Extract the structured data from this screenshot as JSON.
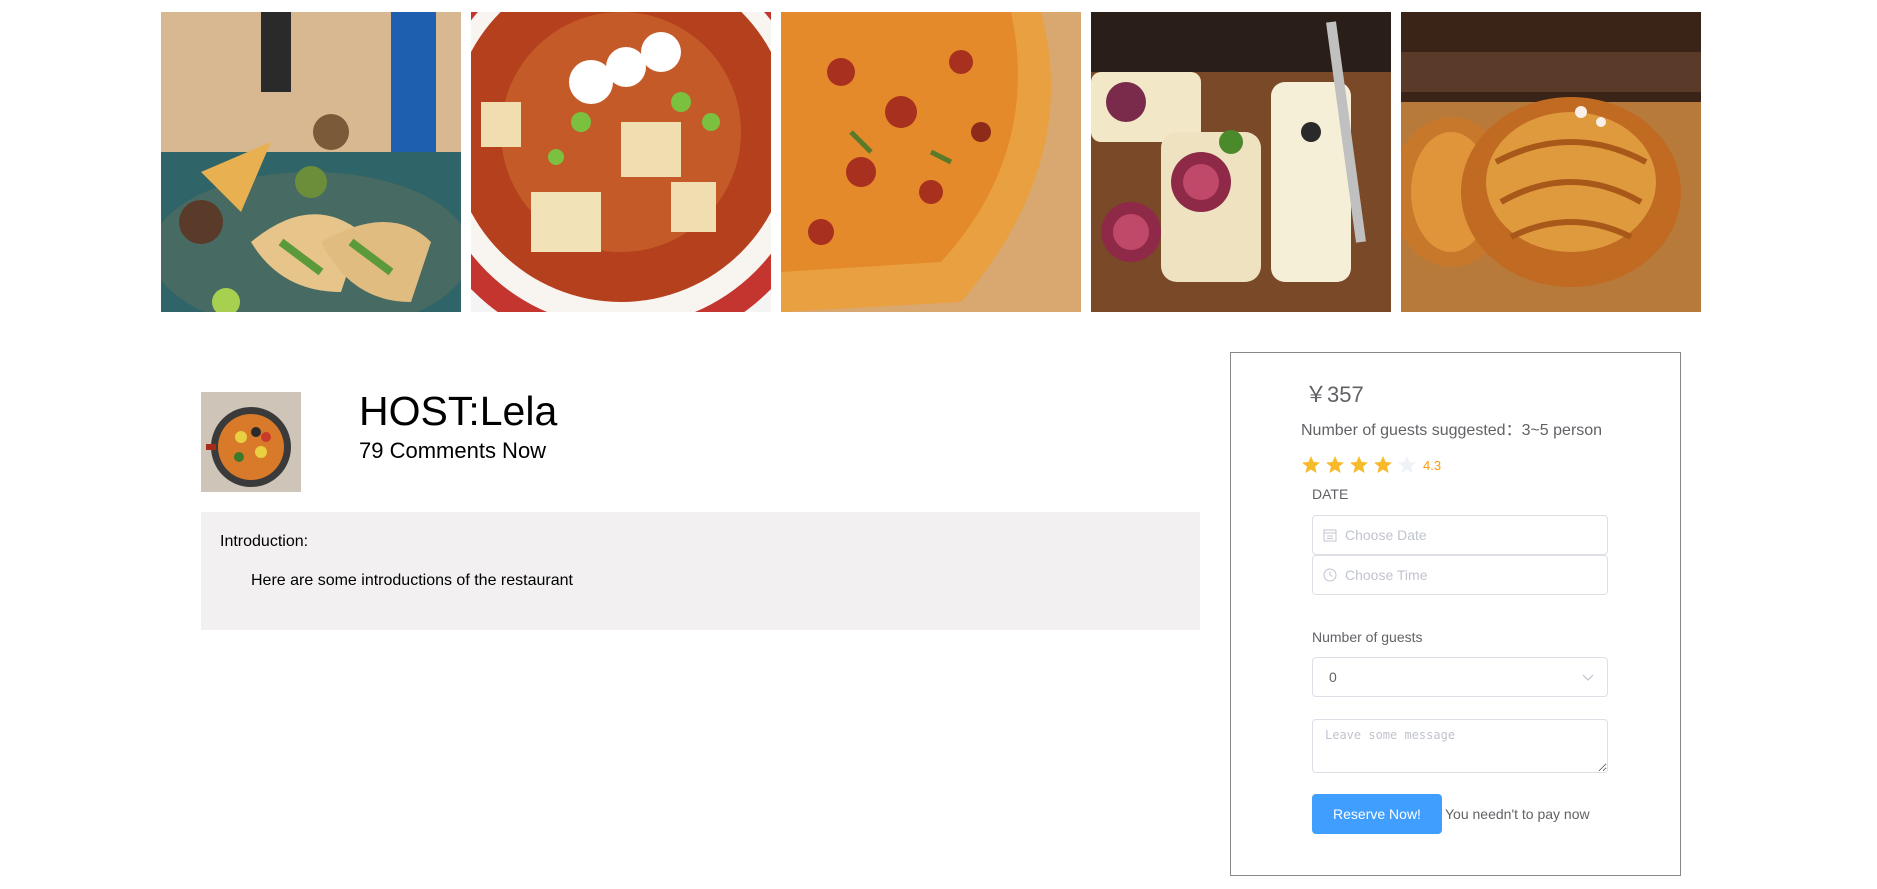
{
  "gallery": {
    "images": [
      {
        "icon": "tacos-photo"
      },
      {
        "icon": "mapo-tofu-photo"
      },
      {
        "icon": "pizza-photo"
      },
      {
        "icon": "fig-bruschetta-photo"
      },
      {
        "icon": "croissant-photo"
      }
    ]
  },
  "host": {
    "avatar_icon": "paella-avatar",
    "name": "HOST:Lela",
    "comments": "79 Comments Now"
  },
  "intro": {
    "title": "Introduction:",
    "text": "Here are some introductions of the restaurant"
  },
  "booking": {
    "price": "￥357",
    "guests_suggested": "Number of guests suggested：3~5 person",
    "rating": {
      "value": 4.3,
      "label": "4.3",
      "max": 5,
      "color": "#f7ba2a",
      "empty_color": "#eff2f7"
    },
    "date_label": "DATE",
    "date_placeholder": "Choose Date",
    "time_placeholder": "Choose Time",
    "guests_label": "Number of guests",
    "guests_value": "0",
    "message_placeholder": "Leave some message",
    "reserve_label": "Reserve Now!",
    "pay_note": "You needn't to pay now",
    "accent_color": "#409eff"
  }
}
